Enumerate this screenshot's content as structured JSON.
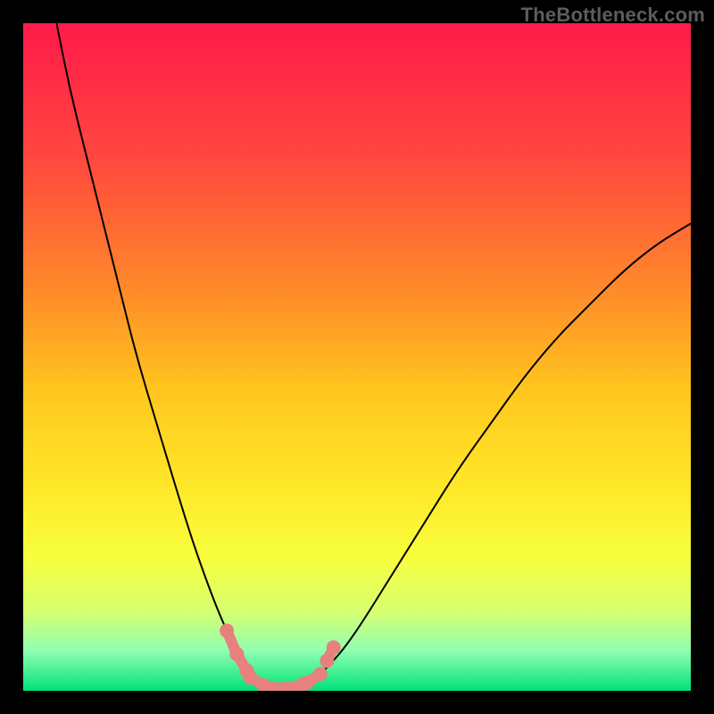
{
  "attribution": "TheBottleneck.com",
  "chart_data": {
    "type": "line",
    "title": "",
    "xlabel": "",
    "ylabel": "",
    "xlim": [
      0,
      100
    ],
    "ylim": [
      0,
      100
    ],
    "grid": false,
    "legend": false,
    "background_gradient_stops": [
      {
        "offset": 0.0,
        "color": "#ff1a4a"
      },
      {
        "offset": 0.2,
        "color": "#ff473e"
      },
      {
        "offset": 0.4,
        "color": "#ff8a2a"
      },
      {
        "offset": 0.55,
        "color": "#ffc61e"
      },
      {
        "offset": 0.7,
        "color": "#ffe92a"
      },
      {
        "offset": 0.8,
        "color": "#f7ff3d"
      },
      {
        "offset": 0.88,
        "color": "#d8ff70"
      },
      {
        "offset": 0.94,
        "color": "#8fffb0"
      },
      {
        "offset": 1.0,
        "color": "#00e27a"
      }
    ],
    "series": [
      {
        "name": "left-curve",
        "stroke": "#000000",
        "width": 2.0,
        "points": [
          {
            "x": 5.0,
            "y": 100.0
          },
          {
            "x": 7.0,
            "y": 90.0
          },
          {
            "x": 9.5,
            "y": 80.0
          },
          {
            "x": 12.0,
            "y": 70.0
          },
          {
            "x": 14.5,
            "y": 60.0
          },
          {
            "x": 17.0,
            "y": 50.0
          },
          {
            "x": 20.0,
            "y": 40.0
          },
          {
            "x": 23.0,
            "y": 30.0
          },
          {
            "x": 25.5,
            "y": 22.0
          },
          {
            "x": 28.0,
            "y": 15.0
          },
          {
            "x": 30.0,
            "y": 10.0
          },
          {
            "x": 32.0,
            "y": 6.0
          },
          {
            "x": 34.0,
            "y": 3.0
          },
          {
            "x": 36.0,
            "y": 1.0
          },
          {
            "x": 38.0,
            "y": 0.0
          }
        ]
      },
      {
        "name": "right-curve",
        "stroke": "#000000",
        "width": 2.0,
        "points": [
          {
            "x": 38.0,
            "y": 0.0
          },
          {
            "x": 41.0,
            "y": 0.5
          },
          {
            "x": 44.0,
            "y": 2.0
          },
          {
            "x": 47.0,
            "y": 5.0
          },
          {
            "x": 50.0,
            "y": 9.0
          },
          {
            "x": 55.0,
            "y": 17.0
          },
          {
            "x": 60.0,
            "y": 25.0
          },
          {
            "x": 65.0,
            "y": 33.0
          },
          {
            "x": 70.0,
            "y": 40.0
          },
          {
            "x": 75.0,
            "y": 47.0
          },
          {
            "x": 80.0,
            "y": 53.0
          },
          {
            "x": 85.0,
            "y": 58.0
          },
          {
            "x": 90.0,
            "y": 63.0
          },
          {
            "x": 95.0,
            "y": 67.0
          },
          {
            "x": 100.0,
            "y": 70.0
          }
        ]
      }
    ],
    "markers": {
      "name": "bottom-cluster",
      "stroke": "#e6817e",
      "fill": "#e6817e",
      "radius": 8,
      "link_width": 12,
      "pairs": [
        {
          "a": {
            "x": 30.5,
            "y": 9.0
          },
          "b": {
            "x": 32.0,
            "y": 5.5
          }
        },
        {
          "a": {
            "x": 32.0,
            "y": 5.5
          },
          "b": {
            "x": 33.5,
            "y": 3.0
          }
        },
        {
          "a": {
            "x": 34.0,
            "y": 2.0
          },
          "b": {
            "x": 36.0,
            "y": 0.8
          }
        },
        {
          "a": {
            "x": 36.0,
            "y": 0.8
          },
          "b": {
            "x": 39.0,
            "y": 0.3
          }
        },
        {
          "a": {
            "x": 39.0,
            "y": 0.3
          },
          "b": {
            "x": 42.0,
            "y": 1.0
          }
        },
        {
          "a": {
            "x": 42.5,
            "y": 1.2
          },
          "b": {
            "x": 44.5,
            "y": 2.5
          }
        },
        {
          "a": {
            "x": 45.5,
            "y": 4.5
          },
          "b": {
            "x": 46.5,
            "y": 6.5
          }
        }
      ]
    }
  }
}
